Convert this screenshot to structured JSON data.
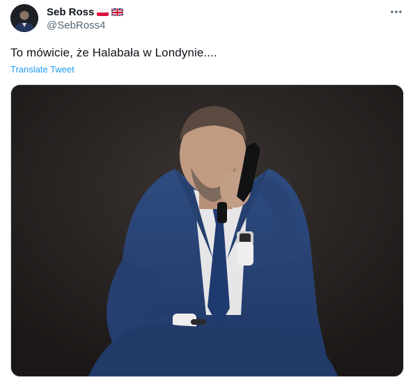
{
  "author": {
    "display_name": "Seb Ross",
    "handle": "@SebRoss4",
    "flags": [
      "flag-poland",
      "flag-united-kingdom"
    ],
    "avatar_icon": "profile-photo"
  },
  "tweet": {
    "text": "To mówicie, że Halabała w Londynie....",
    "translate_label": "Translate Tweet"
  },
  "icons": {
    "more": "more-dots-icon"
  },
  "media": {
    "alt": "Photo of a man in a blue suit holding a black handgun near his face, seated against a dark background"
  },
  "colors": {
    "text_primary": "#0f1419",
    "text_secondary": "#536471",
    "link": "#1d9bf0",
    "border": "#cfd9de"
  }
}
